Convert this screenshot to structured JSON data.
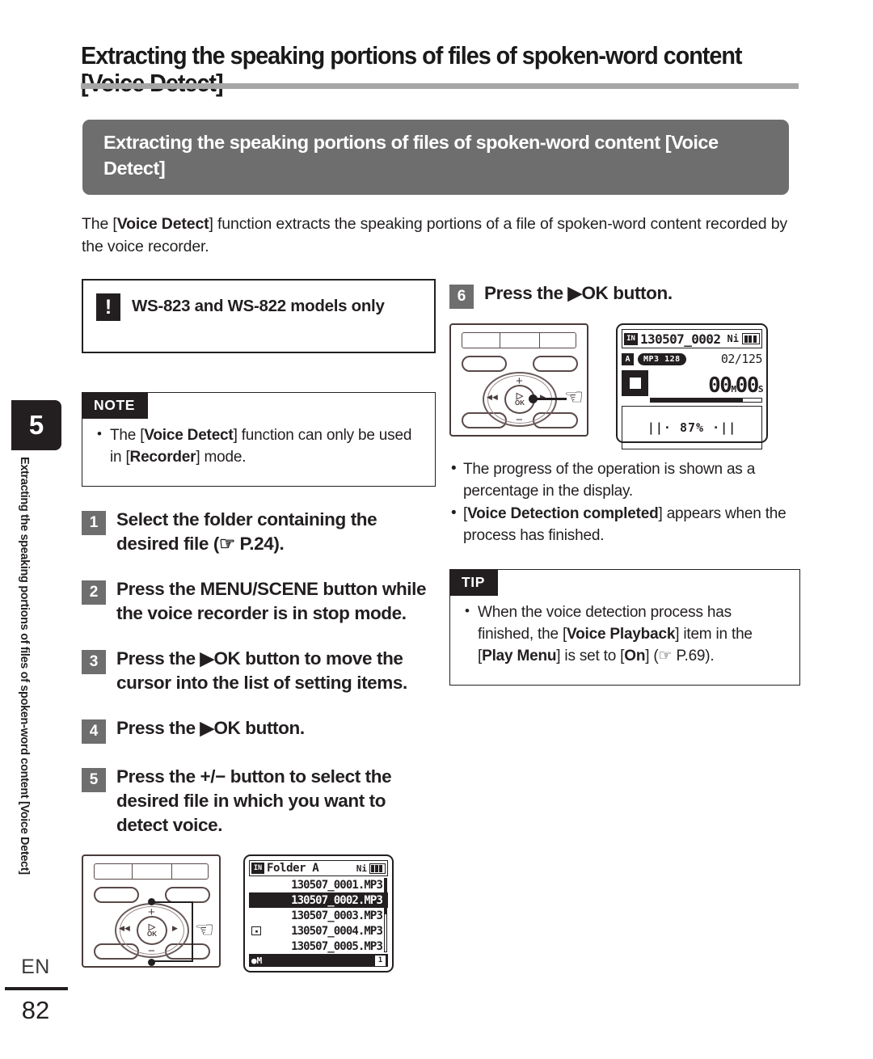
{
  "page_title": "Extracting the speaking portions of files of spoken-word content [Voice Detect]",
  "section_header": "Extracting the speaking portions of files of spoken-word content [Voice Detect]",
  "intro": {
    "part1": "The [",
    "bold1": "Voice Detect",
    "part2": "] function extracts the speaking portions of a file of spoken-word content recorded by the voice recorder."
  },
  "caution": {
    "icon": "!",
    "text": "WS-823 and WS-822 models only"
  },
  "note": {
    "tag": "NOTE",
    "items": [
      {
        "part1": "The [",
        "bold1": "Voice Detect",
        "part2": "] function can only be used in [",
        "bold2": "Recorder",
        "part3": "] mode."
      }
    ]
  },
  "tip": {
    "tag": "TIP",
    "items": [
      {
        "part1": "When the voice detection process has finished, the [",
        "bold1": "Voice Playback",
        "part2": "] item in the [",
        "bold2": "Play Menu",
        "part3": "] is set to [",
        "bold3": "On",
        "part4": "] (☞ P.69)."
      }
    ]
  },
  "steps": [
    {
      "num": "1",
      "text": "Select the folder containing the desired file (☞ P.24)."
    },
    {
      "num": "2",
      "text": "Press the MENU/SCENE button while the voice recorder is in stop mode."
    },
    {
      "num": "3",
      "text": "Press the ▶OK button to move the cursor into the list of setting items."
    },
    {
      "num": "4",
      "text": "Press the ▶OK button."
    },
    {
      "num": "5",
      "text": "Press the +/− button to select the desired file in which you want to detect voice."
    },
    {
      "num": "6",
      "text": "Press the ▶OK button."
    }
  ],
  "progress_notes": [
    {
      "part1": "The progress of the operation is shown as a percentage in the display.",
      "bold1": "",
      "part2": ""
    },
    {
      "part1": "[",
      "bold1": "Voice Detection completed",
      "part2": "] appears when the process has finished."
    }
  ],
  "lcd_step6": {
    "in_tag": "IN",
    "filename": "130507_0002",
    "battery_label": "Ni",
    "a_tag": "A",
    "codec": "MP3 128",
    "file_count": "02/125",
    "time_minutes": "00",
    "minutes_unit": "M",
    "time_seconds": "00",
    "seconds_unit": "S",
    "progress_bar_percent": 83,
    "progress_text": "||· 87% ·||"
  },
  "lcd_step5": {
    "in_tag": "IN",
    "folder": "Folder A",
    "battery_label": "Ni",
    "files": [
      {
        "name": "130507_0001.MP3",
        "selected": false,
        "marked": false
      },
      {
        "name": "130507_0002.MP3",
        "selected": true,
        "marked": false
      },
      {
        "name": "130507_0003.MP3",
        "selected": false,
        "marked": false
      },
      {
        "name": "130507_0004.MP3",
        "selected": false,
        "marked": true
      },
      {
        "name": "130507_0005.MP3",
        "selected": false,
        "marked": false
      }
    ],
    "footer_left": "M",
    "footer_badge": "1"
  },
  "device": {
    "ok_label": "OK",
    "plus": "+",
    "minus": "−",
    "rew": "◀◀",
    "ff": "▶"
  },
  "sidebar": {
    "chapter": "5",
    "vertical_text": "Extracting the speaking portions of files of spoken-word content [Voice Detect]",
    "lang": "EN",
    "page": "82"
  },
  "colors": {
    "header_gray": "#6e6e6e",
    "rule_gray": "#a6a6a6",
    "ink": "#231f20"
  }
}
